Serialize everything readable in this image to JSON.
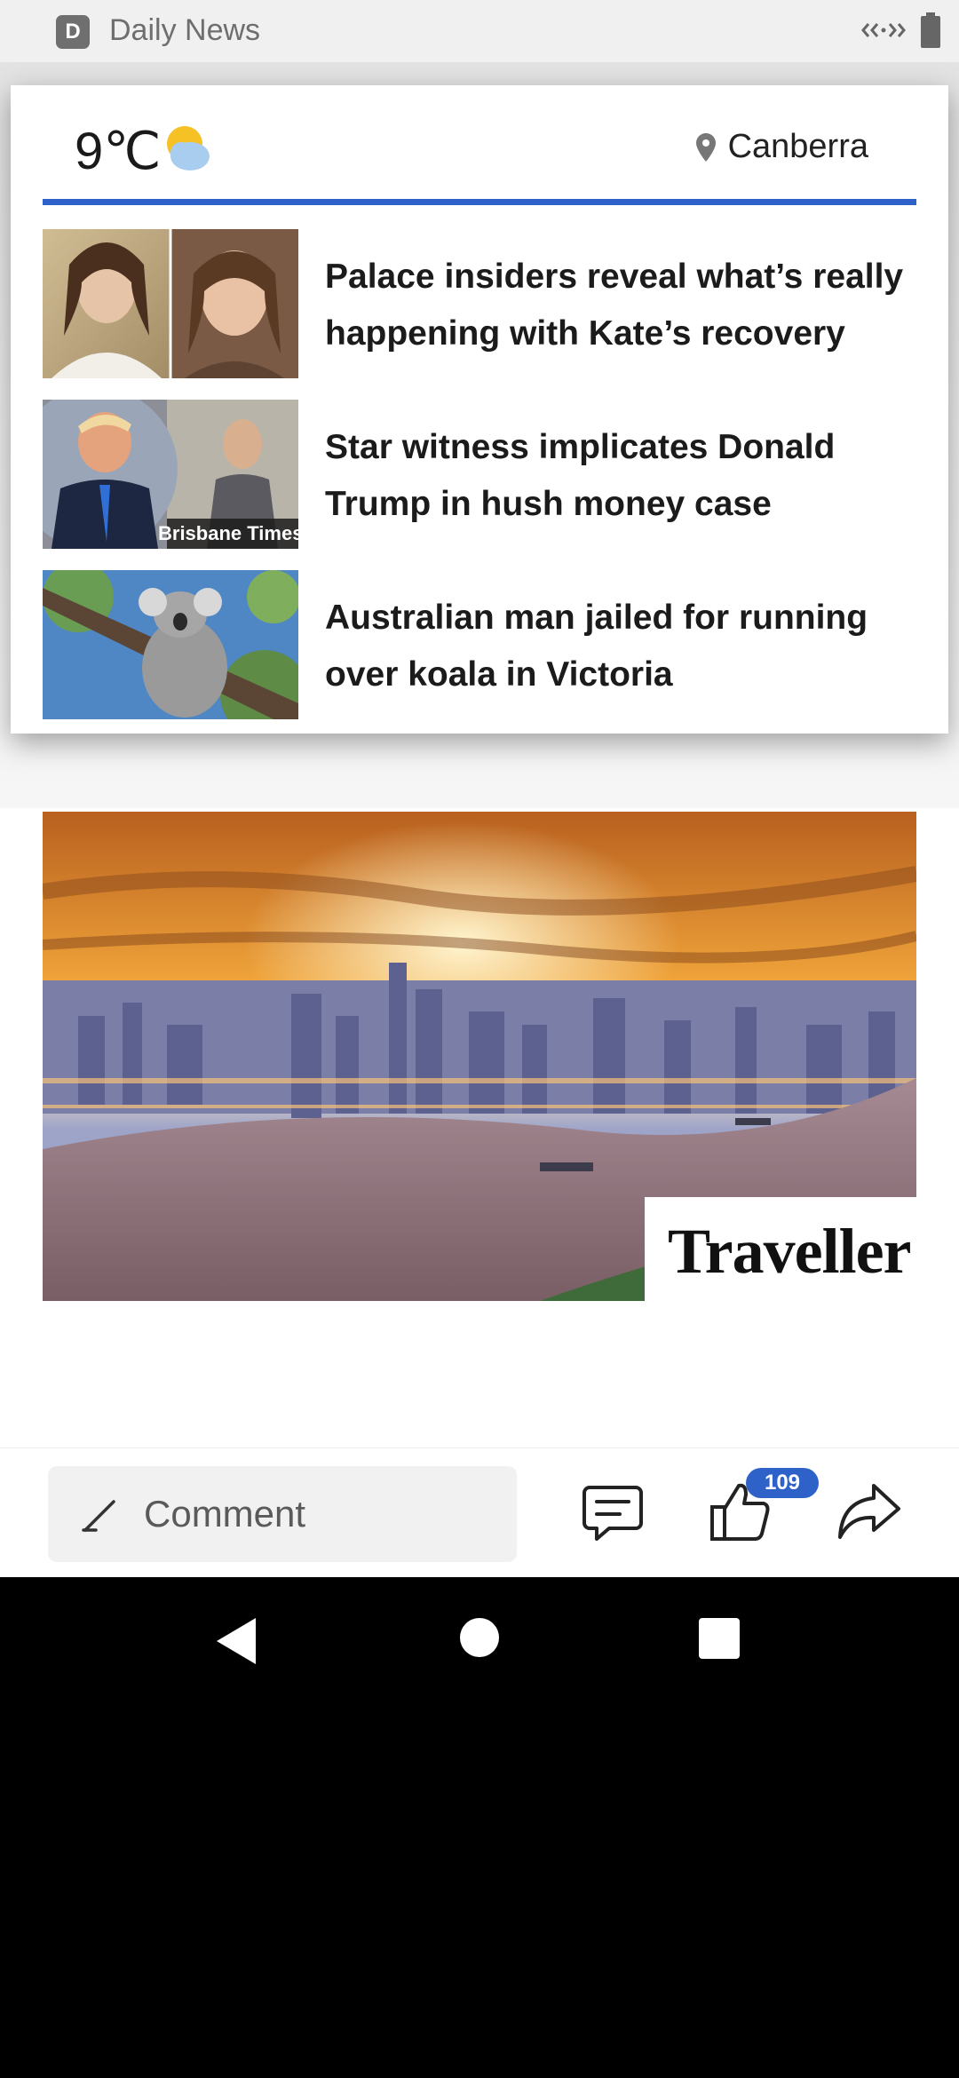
{
  "app": {
    "title": "Daily News",
    "logo_letter": "D"
  },
  "weather": {
    "temperature": "9℃",
    "icon": "partly-cloudy-icon",
    "location": "Canberra"
  },
  "news": [
    {
      "headline": "Palace insiders reveal what’s really happening with Kate’s recovery"
    },
    {
      "headline": "Star witness implicates Donald Trump in hush money case",
      "thumb_caption": "Brisbane Times"
    },
    {
      "headline": "Australian man jailed for running over koala in Victoria"
    }
  ],
  "hero": {
    "brand": "Traveller"
  },
  "actions": {
    "comment_placeholder": "Comment",
    "like_count": "109"
  },
  "colors": {
    "accent": "#2f62c9",
    "badge": "#2e62c8"
  }
}
